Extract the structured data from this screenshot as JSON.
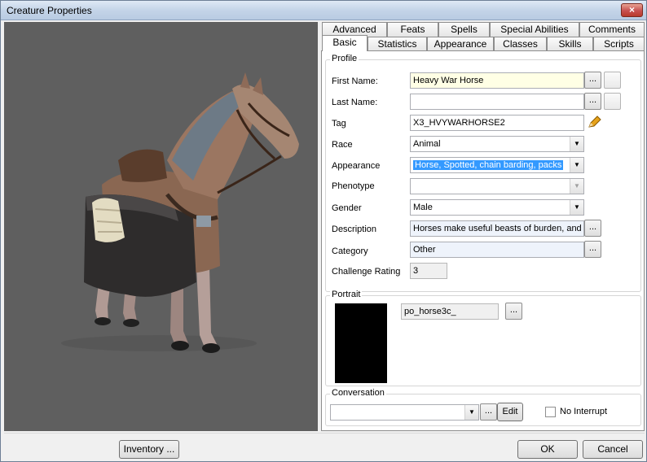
{
  "window": {
    "title": "Creature Properties",
    "close_label": "×"
  },
  "tabs_row1": [
    "Advanced",
    "Feats",
    "Spells",
    "Special Abilities",
    "Comments"
  ],
  "tabs_row2": [
    "Basic",
    "Statistics",
    "Appearance",
    "Classes",
    "Skills",
    "Scripts"
  ],
  "profile": {
    "group_label": "Profile",
    "first_name_label": "First Name:",
    "first_name_value": "Heavy War Horse",
    "last_name_label": "Last Name:",
    "last_name_value": "",
    "tag_label": "Tag",
    "tag_value": "X3_HVYWARHORSE2",
    "race_label": "Race",
    "race_value": "Animal",
    "appearance_label": "Appearance",
    "appearance_value": "Horse, Spotted, chain barding, packs",
    "phenotype_label": "Phenotype",
    "phenotype_value": "",
    "gender_label": "Gender",
    "gender_value": "Male",
    "description_label": "Description",
    "description_value": "Horses make useful beasts of burden, and th",
    "category_label": "Category",
    "category_value": "Other",
    "challenge_label": "Challenge Rating",
    "challenge_value": "3",
    "ellipsis": "..."
  },
  "portrait": {
    "group_label": "Portrait",
    "value": "po_horse3c_",
    "ellipsis": "..."
  },
  "conversation": {
    "group_label": "Conversation",
    "value": "",
    "ellipsis": "...",
    "edit_label": "Edit",
    "no_interrupt_label": "No Interrupt"
  },
  "footer": {
    "inventory_label": "Inventory ...",
    "ok_label": "OK",
    "cancel_label": "Cancel"
  },
  "icons": {
    "dropdown": "▼",
    "pencil": "pencil-icon"
  }
}
